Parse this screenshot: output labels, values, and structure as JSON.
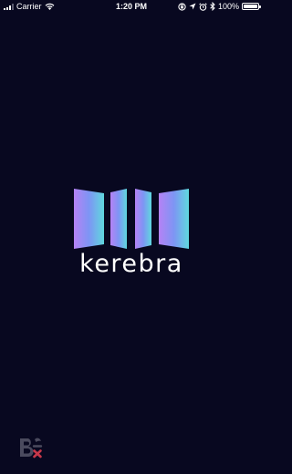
{
  "status_bar": {
    "carrier": "Carrier",
    "time": "1:20 PM",
    "battery_percent": "100%",
    "battery_level": 1.0,
    "icons": [
      "signal-icon",
      "wifi-icon",
      "screen-lock-icon",
      "location-icon",
      "alarm-icon",
      "bluetooth-icon",
      "battery-icon"
    ]
  },
  "splash": {
    "app_name": "kerebra",
    "logo": {
      "gradient_start": "#b582f5",
      "gradient_mid": "#7e95f4",
      "gradient_end": "#5fd8de"
    }
  },
  "colors": {
    "background": "#080820",
    "text": "#ffffff"
  },
  "corner_badge": {
    "icon": "be-logo-icon"
  }
}
